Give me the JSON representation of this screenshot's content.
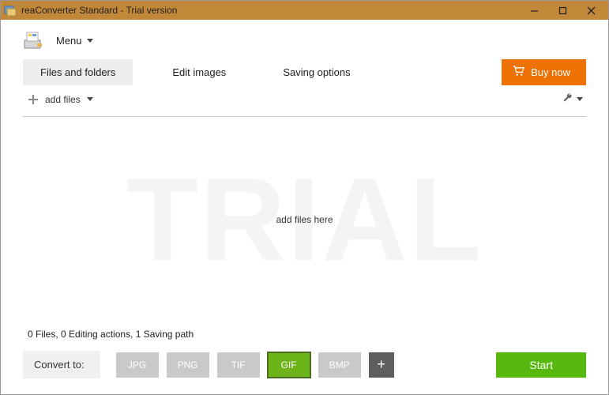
{
  "window": {
    "title": "reaConverter Standard - Trial version"
  },
  "menu": {
    "label": "Menu"
  },
  "tabs": {
    "files": "Files and folders",
    "edit": "Edit images",
    "saving": "Saving options"
  },
  "buy": {
    "label": "Buy now"
  },
  "addfiles": {
    "label": "add files"
  },
  "drop": {
    "watermark": "TRIAL",
    "hint": "add files here"
  },
  "status": {
    "text": "0 Files, 0 Editing actions, 1 Saving path"
  },
  "bottom": {
    "convert_label": "Convert to:",
    "formats": {
      "jpg": "JPG",
      "png": "PNG",
      "tif": "TIF",
      "gif": "GIF",
      "bmp": "BMP"
    },
    "start": "Start"
  }
}
